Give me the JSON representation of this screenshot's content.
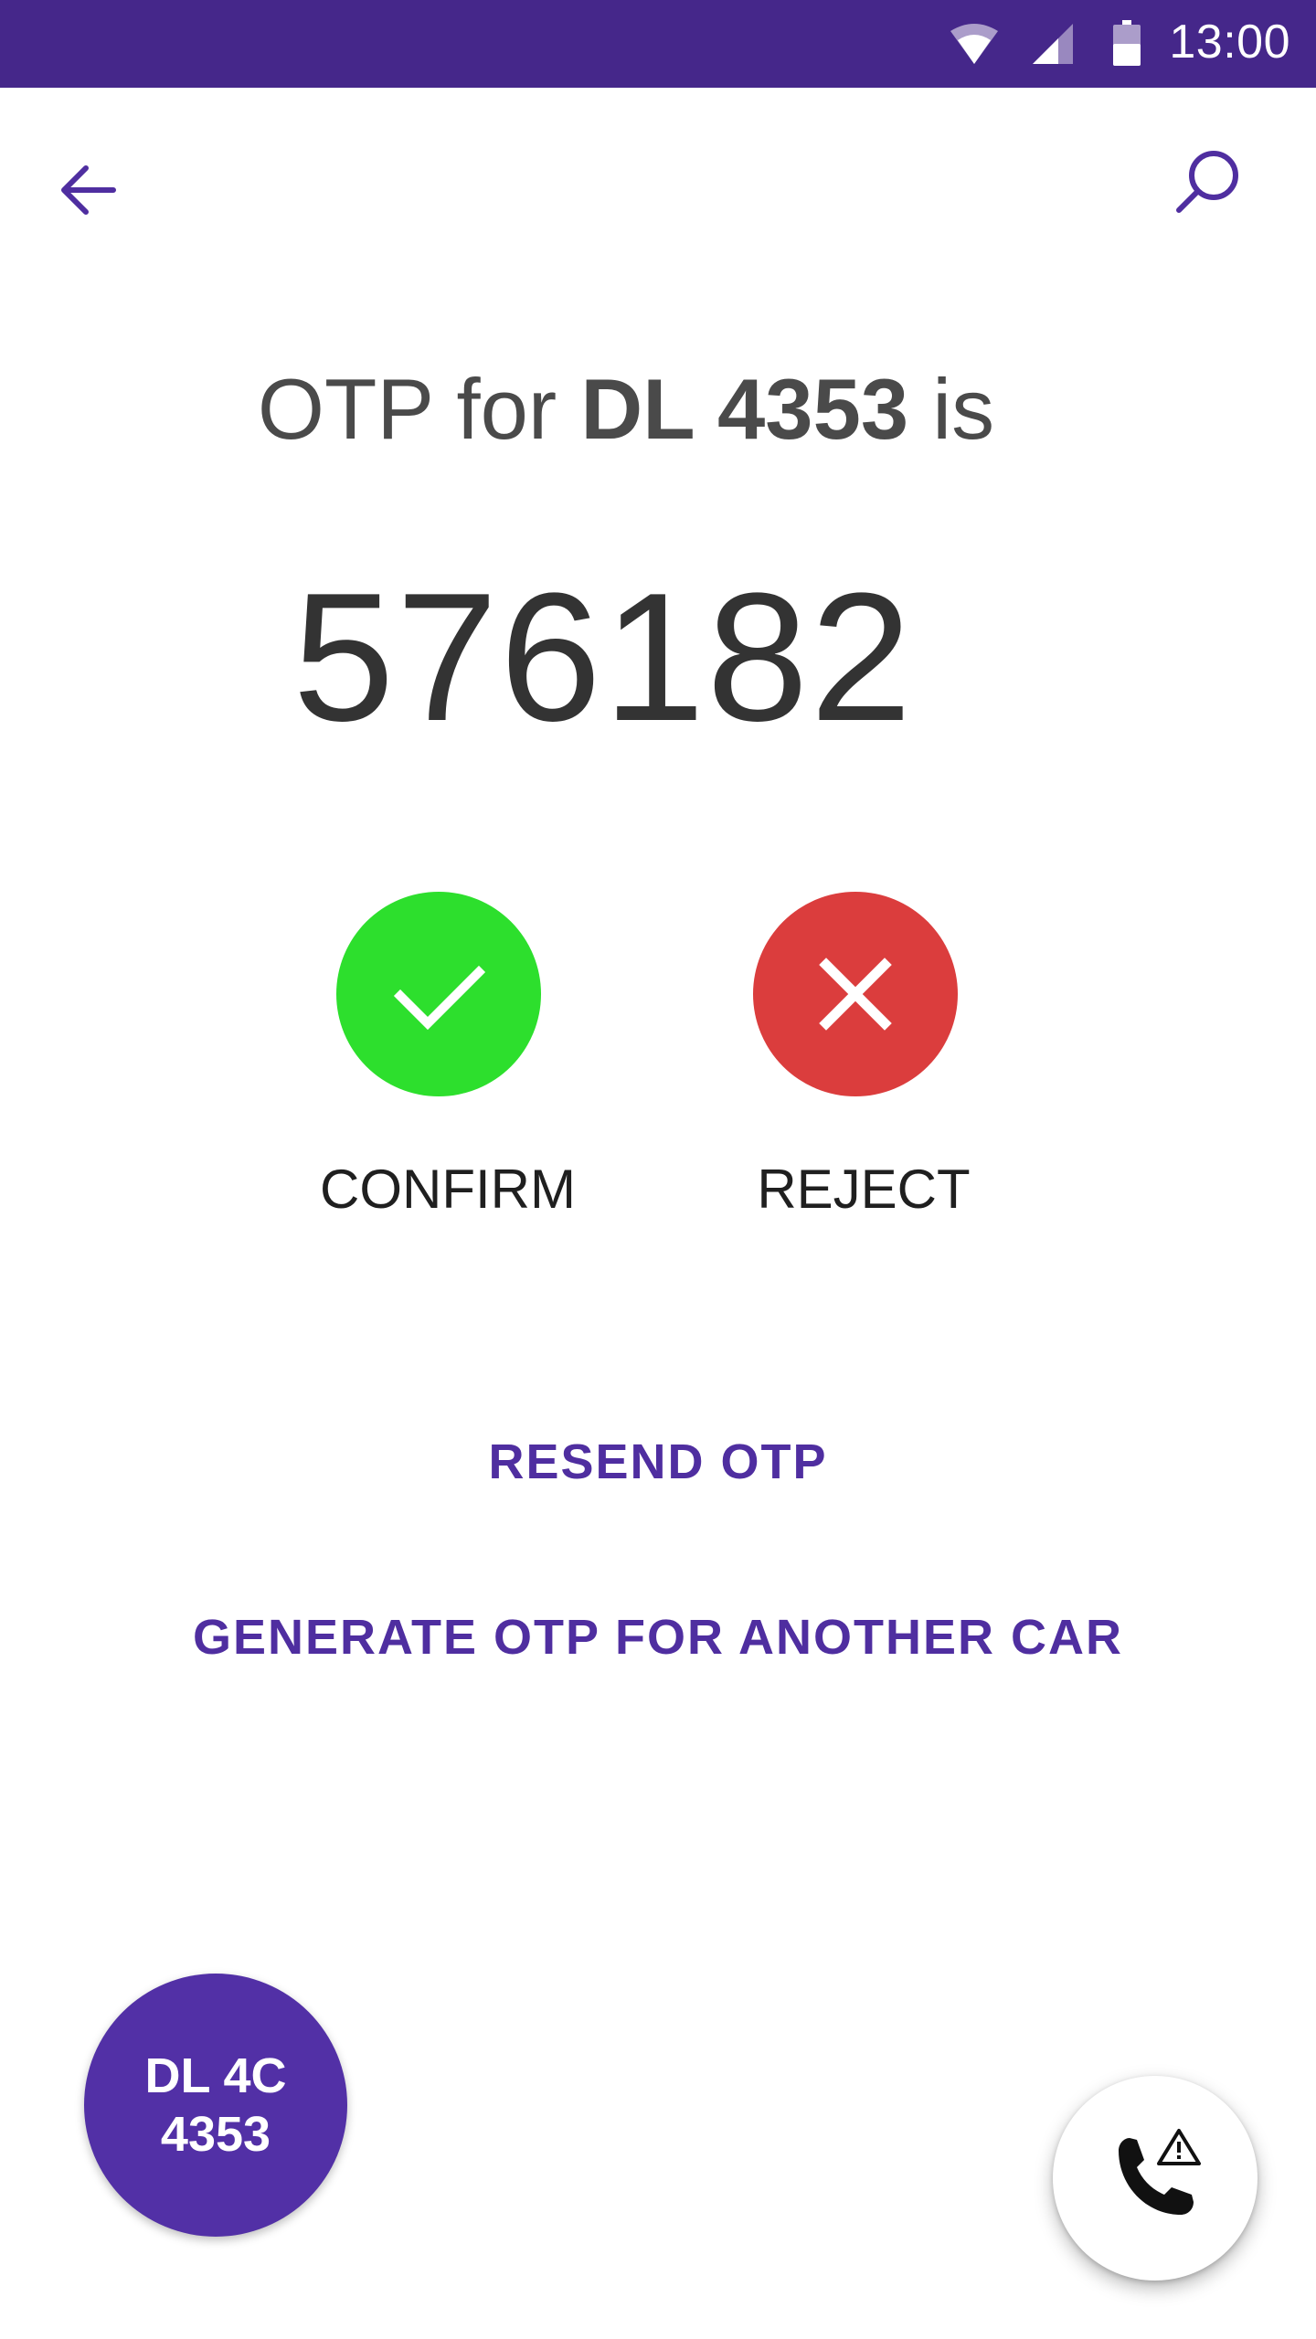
{
  "status_bar": {
    "time": "13:00",
    "icons": [
      "wifi-icon",
      "cell-signal-icon",
      "battery-icon"
    ],
    "background_color": "#45278a"
  },
  "toolbar": {
    "back_icon": "arrow-back-icon",
    "search_icon": "search-icon",
    "icon_color": "#4f2ea0"
  },
  "otp": {
    "prefix": "OTP for ",
    "car_id": "DL 4353",
    "suffix": " is",
    "code": "576182"
  },
  "actions": {
    "confirm_label": "CONFIRM",
    "confirm_icon": "check-icon",
    "confirm_color": "#2ddf2d",
    "reject_label": "REJECT",
    "reject_icon": "close-icon",
    "reject_color": "#db3d3d"
  },
  "links": {
    "resend_label": "RESEND OTP",
    "generate_label": "GENERATE OTP FOR ANOTHER CAR",
    "color": "#4f2ea0"
  },
  "car_badge": {
    "line1": "DL 4C",
    "line2": "4353",
    "color": "#5230a6"
  },
  "emergency_fab": {
    "icon": "phone-alert-icon"
  }
}
